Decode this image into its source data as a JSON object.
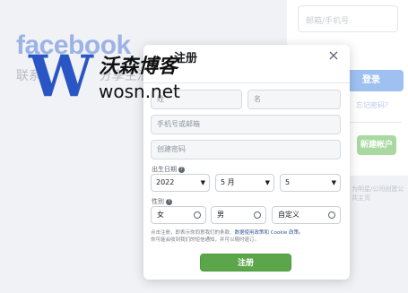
{
  "background": {
    "brand": "facebook",
    "tagline": "联系",
    "tagline_tail": "分享生活。",
    "email_placeholder": "邮箱/手机号",
    "login_label": "登录",
    "forgot_label": "忘记密码？",
    "create_label": "新建帐户",
    "note": "为明星/公司创建公共主页"
  },
  "modal": {
    "title": "注册",
    "close_icon": "×",
    "first_name_placeholder": "姓",
    "last_name_placeholder": "名",
    "phone_email_placeholder": "手机号或邮箱",
    "password_placeholder": "创建密码",
    "birthday_label": "出生日期",
    "birthday": {
      "year": "2022",
      "month": "5 月",
      "day": "5"
    },
    "gender_label": "性别",
    "genders": [
      "女",
      "男",
      "自定义"
    ],
    "terms_text": "点击注册，即表示你同意我们的条款、",
    "terms_link": "数据使用政策和 Cookie 政策。",
    "terms_text2": "你可能会收到我们的短信通知，并可以随时退订。",
    "submit_label": "注册"
  },
  "watermark": {
    "logo_letter": "W",
    "name": "沃森博客",
    "url": "wosn.net"
  },
  "colors": {
    "submit": "#5ba64a",
    "watermark_blue": "#2a55c4",
    "fb_blue": "#9db3e6"
  }
}
